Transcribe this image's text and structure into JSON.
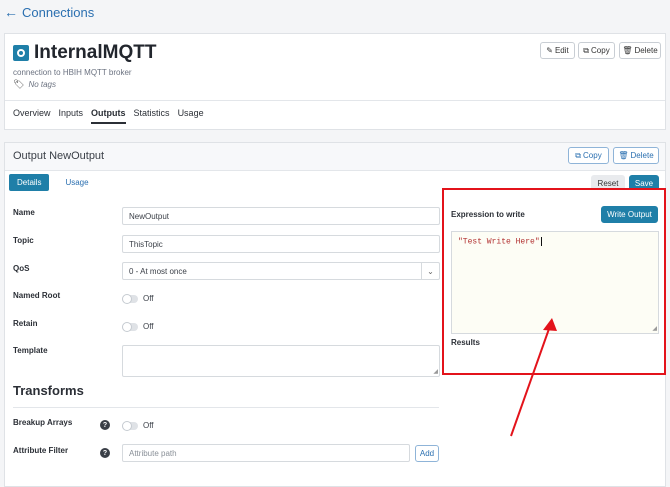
{
  "nav": {
    "back_label": "Connections"
  },
  "connection": {
    "name": "InternalMQTT",
    "description": "connection to HBIH MQTT broker",
    "tags": "No tags",
    "actions": {
      "edit": "Edit",
      "copy": "Copy",
      "delete": "Delete"
    },
    "tabs": [
      {
        "label": "Overview",
        "active": false
      },
      {
        "label": "Inputs",
        "active": false
      },
      {
        "label": "Outputs",
        "active": true
      },
      {
        "label": "Statistics",
        "active": false
      },
      {
        "label": "Usage",
        "active": false
      }
    ]
  },
  "output": {
    "title": "Output NewOutput",
    "actions": {
      "copy": "Copy",
      "delete": "Delete",
      "reset": "Reset",
      "save": "Save"
    },
    "tabs": [
      {
        "label": "Details",
        "active": true
      },
      {
        "label": "Usage",
        "active": false
      }
    ],
    "fields": {
      "name": {
        "label": "Name",
        "value": "NewOutput"
      },
      "topic": {
        "label": "Topic",
        "value": "ThisTopic"
      },
      "qos": {
        "label": "QoS",
        "value": "0 - At most once"
      },
      "named_root": {
        "label": "Named Root",
        "state": "Off"
      },
      "retain": {
        "label": "Retain",
        "state": "Off"
      },
      "template": {
        "label": "Template",
        "value": ""
      }
    },
    "transforms": {
      "title": "Transforms",
      "breakup_arrays": {
        "label": "Breakup Arrays",
        "help": "?",
        "state": "Off"
      },
      "attribute_filter": {
        "label": "Attribute Filter",
        "help": "?",
        "placeholder": "Attribute path",
        "add_label": "Add"
      }
    }
  },
  "expression": {
    "label": "Expression to write",
    "write_button": "Write Output",
    "code": "\"Test Write Here\"",
    "results_label": "Results"
  },
  "annotation": {
    "highlight_color": "#e3131b"
  }
}
